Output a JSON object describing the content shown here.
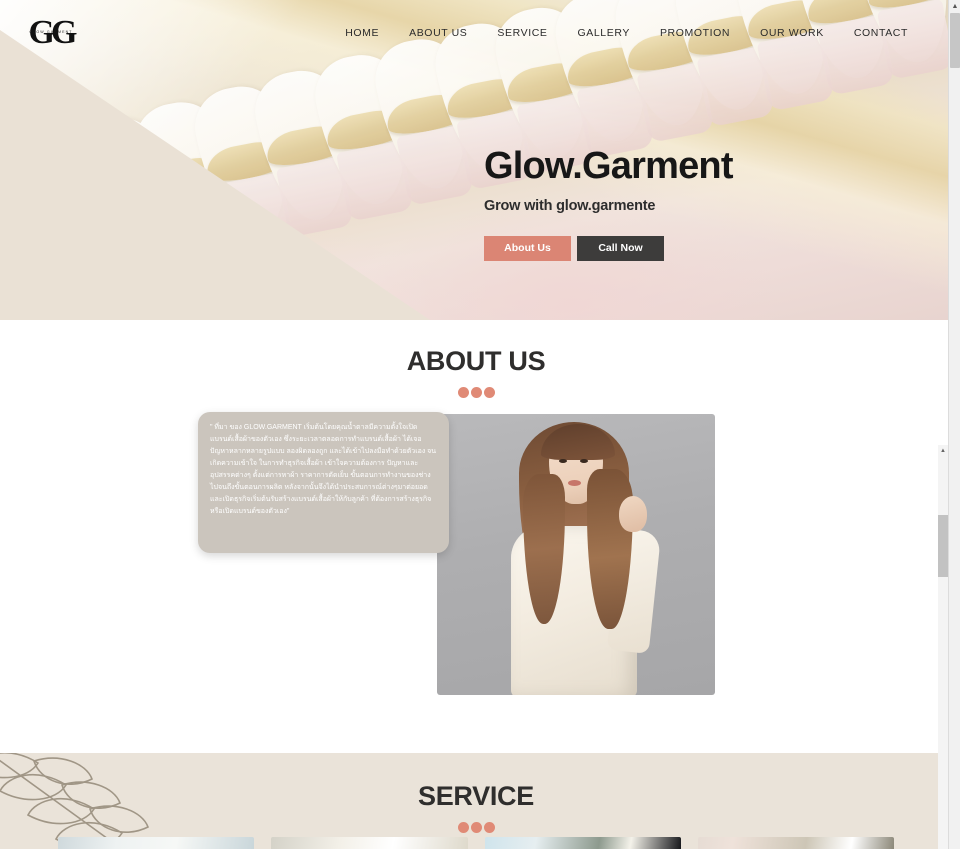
{
  "site": {
    "logo_mark": "GG",
    "logo_subtext": "GLOW GARMENT"
  },
  "nav": {
    "items": [
      {
        "label": "HOME"
      },
      {
        "label": "ABOUT US"
      },
      {
        "label": "SERVICE"
      },
      {
        "label": "GALLERY"
      },
      {
        "label": "PROMOTION"
      },
      {
        "label": "OUR WORK"
      },
      {
        "label": "CONTACT"
      }
    ]
  },
  "hero": {
    "title": "Glow.Garment",
    "subtitle": "Grow with glow.garmente",
    "primary_button": "About Us",
    "secondary_button": "Call Now",
    "primary_button_color": "#db8574",
    "secondary_button_color": "#3d3c3b"
  },
  "about": {
    "title": "ABOUT US",
    "accent_color": "#e08a76",
    "paragraph": "\" ที่มา ของ GLOW.GARMENT เริ่มต้นโดยคุณน้ำตาลมีความตั้งใจเปิดแบรนด์เสื้อผ้าของตัวเอง ซึ่งระยะเวลาตลอดการทำแบรนด์เสื้อผ้า ได้เจอปัญหาหลากหลายรูปแบบ ลองผิดลองถูก และได้เข้าไปลงมือทำด้วยตัวเอง จนเกิดความเข้าใจ ในการทำธุรกิจเสื้อผ้า เข้าใจความต้องการ ปัญหาและอุปสรรคต่างๆ ตั้งแต่การหาผ้า ราคาการตัดเย็บ ขั้นตอนการทำงานของช่าง ไปจนถึงขั้นตอนการผลิต หลังจากนั้นจึงได้นำประสบการณ์ต่างๆมาต่อยอด และเปิดธุรกิจเริ่มต้นรับสร้างแบรนด์เสื้อผ้าให้กับลูกค้า ที่ต้องการสร้างธุรกิจหรือเปิดแบรนด์ของตัวเอง\"",
    "image_alt": "woman-in-white-blazer"
  },
  "service": {
    "title": "SERVICE",
    "accent_color": "#e08a76",
    "cards": [
      {
        "name": "service-card-1"
      },
      {
        "name": "service-card-2"
      },
      {
        "name": "service-card-3"
      },
      {
        "name": "service-card-4"
      }
    ]
  },
  "scrollbars": {
    "outer_arrow": "▲",
    "inner_arrow": "▲"
  }
}
